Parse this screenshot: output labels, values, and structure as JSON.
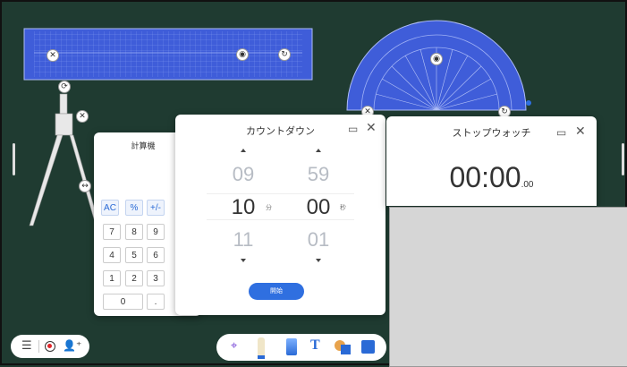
{
  "calculator": {
    "title": "計算機",
    "keys": [
      "AC",
      "%",
      "+/-",
      "7",
      "8",
      "9",
      "4",
      "5",
      "6",
      "1",
      "2",
      "3",
      "0",
      "."
    ]
  },
  "countdown": {
    "title": "カウントダウン",
    "minutes_prev": "09",
    "minutes": "10",
    "minutes_next": "11",
    "minutes_unit": "分",
    "seconds_prev": "59",
    "seconds": "00",
    "seconds_next": "01",
    "seconds_unit": "秒",
    "start_label": "開始",
    "restore_icon": "restore-window-icon",
    "close_icon": "close-icon"
  },
  "stopwatch": {
    "title": "ストップウォッチ",
    "time": "00:00",
    "ms": ".00",
    "restore_icon": "restore-window-icon",
    "close_icon": "close-icon"
  },
  "toolbar_left": {
    "icons": [
      "menu-icon",
      "record-icon",
      "add-user-icon"
    ]
  },
  "toolbar_right": {
    "icons": [
      "select-icon",
      "pen-icon",
      "eraser-icon",
      "text-icon",
      "shapes-icon",
      "media-icon"
    ]
  },
  "colors": {
    "board": "#1f3b31",
    "accent": "#2f6fe0",
    "ruler_blue": "#3f5dd9"
  }
}
